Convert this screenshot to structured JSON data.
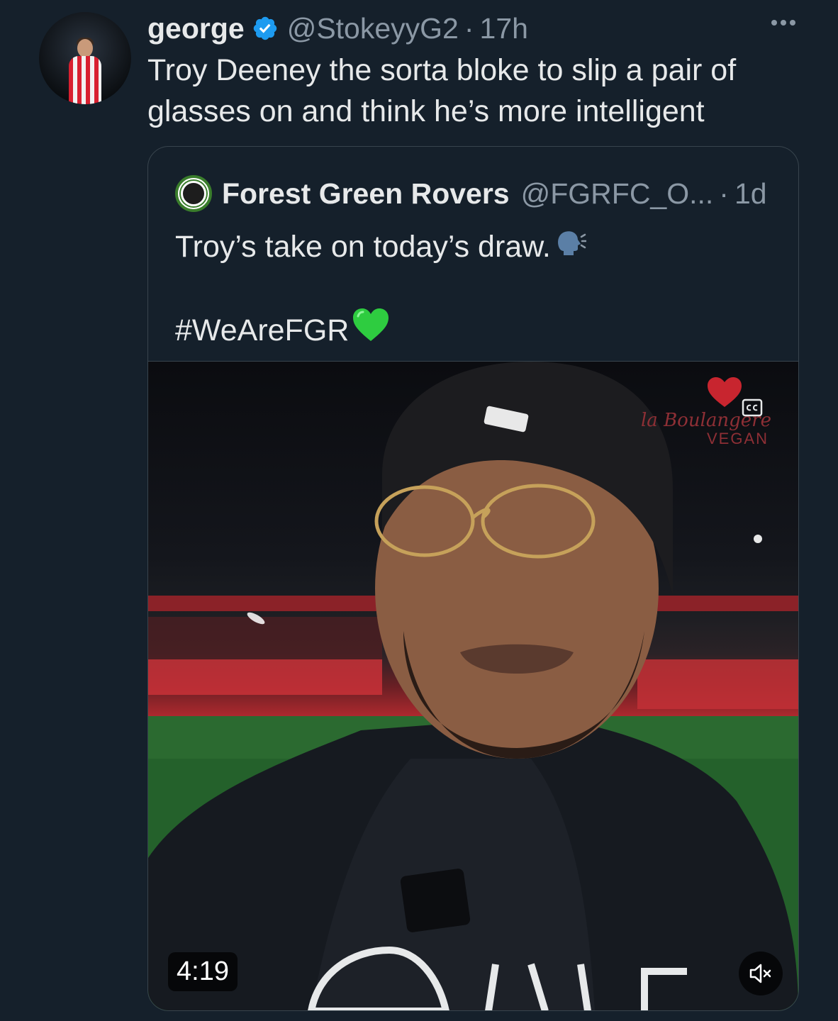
{
  "tweet": {
    "author_name": "george",
    "handle": "@StokeyyG2",
    "separator": "·",
    "time": "17h",
    "text_line1": "Troy Deeney the sorta bloke to slip a pair of",
    "text_line2": "glasses on and think he’s more intelligent",
    "avatar_icon": "profile-avatar-icon",
    "verified_icon": "verified-badge-icon",
    "more_icon": "more-options-icon"
  },
  "quoted": {
    "author_name": "Forest Green Rovers",
    "handle": "@FGRFC_O...",
    "separator": "·",
    "time": "1d",
    "text": "Troy’s take on today’s draw.",
    "speaking_emoji": "speaking-head-icon",
    "hashtag": "#WeAreFGR",
    "heart_emoji": "green-heart-icon",
    "logo_icon": "club-crest-icon"
  },
  "video": {
    "duration": "4:19",
    "mute_icon": "volume-muted-icon",
    "captions_icon": "closed-captions-icon",
    "watermark_brand": "Boulangere",
    "watermark_prefix": "la",
    "watermark_sub": "VEGAN",
    "shirt_text": "CELINE"
  },
  "colors": {
    "background": "#15202b",
    "text": "#e7e9ea",
    "secondary_text": "#8b98a5",
    "verified_blue": "#1d9bf0",
    "border": "#38444d",
    "green_heart": "#2ecc40"
  }
}
